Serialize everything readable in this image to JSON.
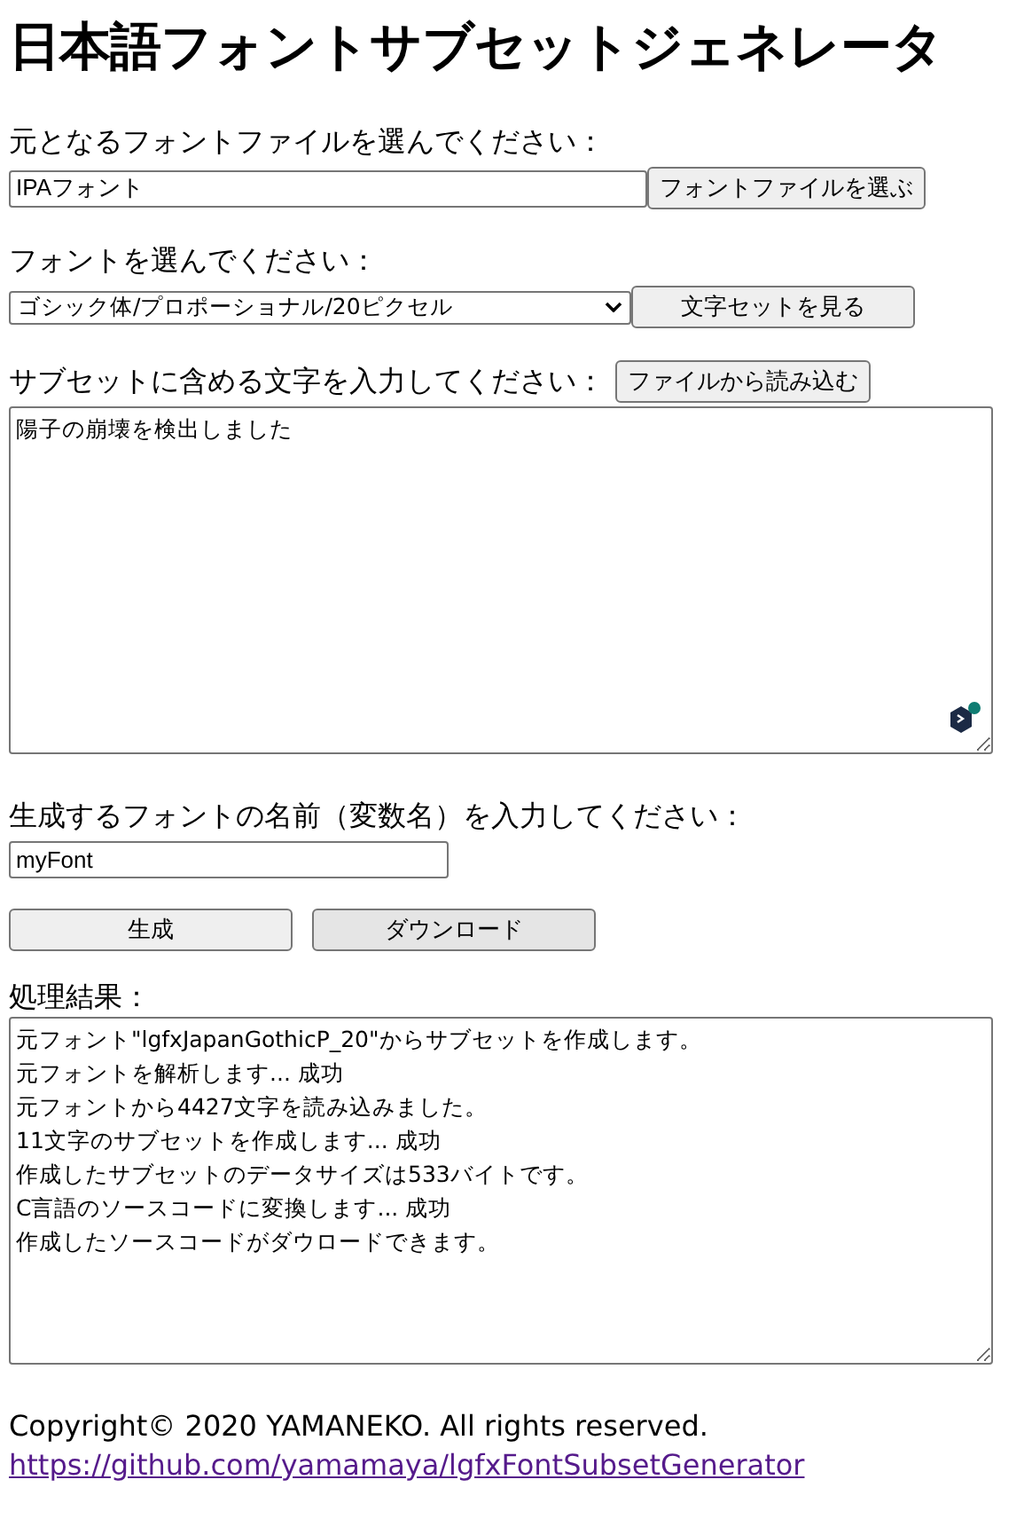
{
  "title": "日本語フォントサブセットジェネレータ",
  "source_font": {
    "label": "元となるフォントファイルを選んでください：",
    "value": "IPAフォント",
    "button": "フォントファイルを選ぶ"
  },
  "font_select": {
    "label": "フォントを選んでください：",
    "value": "ゴシック体/プロポーショナル/20ピクセル",
    "button": "文字セットを見る"
  },
  "characters": {
    "label": "サブセットに含める文字を入力してください：",
    "button": "ファイルから読み込む",
    "value": "陽子の崩壊を検出しました"
  },
  "font_name": {
    "label": "生成するフォントの名前（変数名）を入力してください：",
    "value": "myFont"
  },
  "actions": [
    "生成",
    "ダウンロード"
  ],
  "result": {
    "label": "処理結果：",
    "lines": [
      "元フォント\"lgfxJapanGothicP_20\"からサブセットを作成します。",
      "元フォントを解析します... 成功",
      "元フォントから4427文字を読み込みました。",
      "11文字のサブセットを作成します... 成功",
      "作成したサブセットのデータサイズは533バイトです。",
      "C言語のソースコードに変換します... 成功",
      "作成したソースコードがダウロードできます。"
    ]
  },
  "footer": {
    "copyright": "Copyright© 2020 YAMANEKO. All rights reserved.",
    "link": "https://github.com/yamamaya/lgfxFontSubsetGenerator"
  }
}
